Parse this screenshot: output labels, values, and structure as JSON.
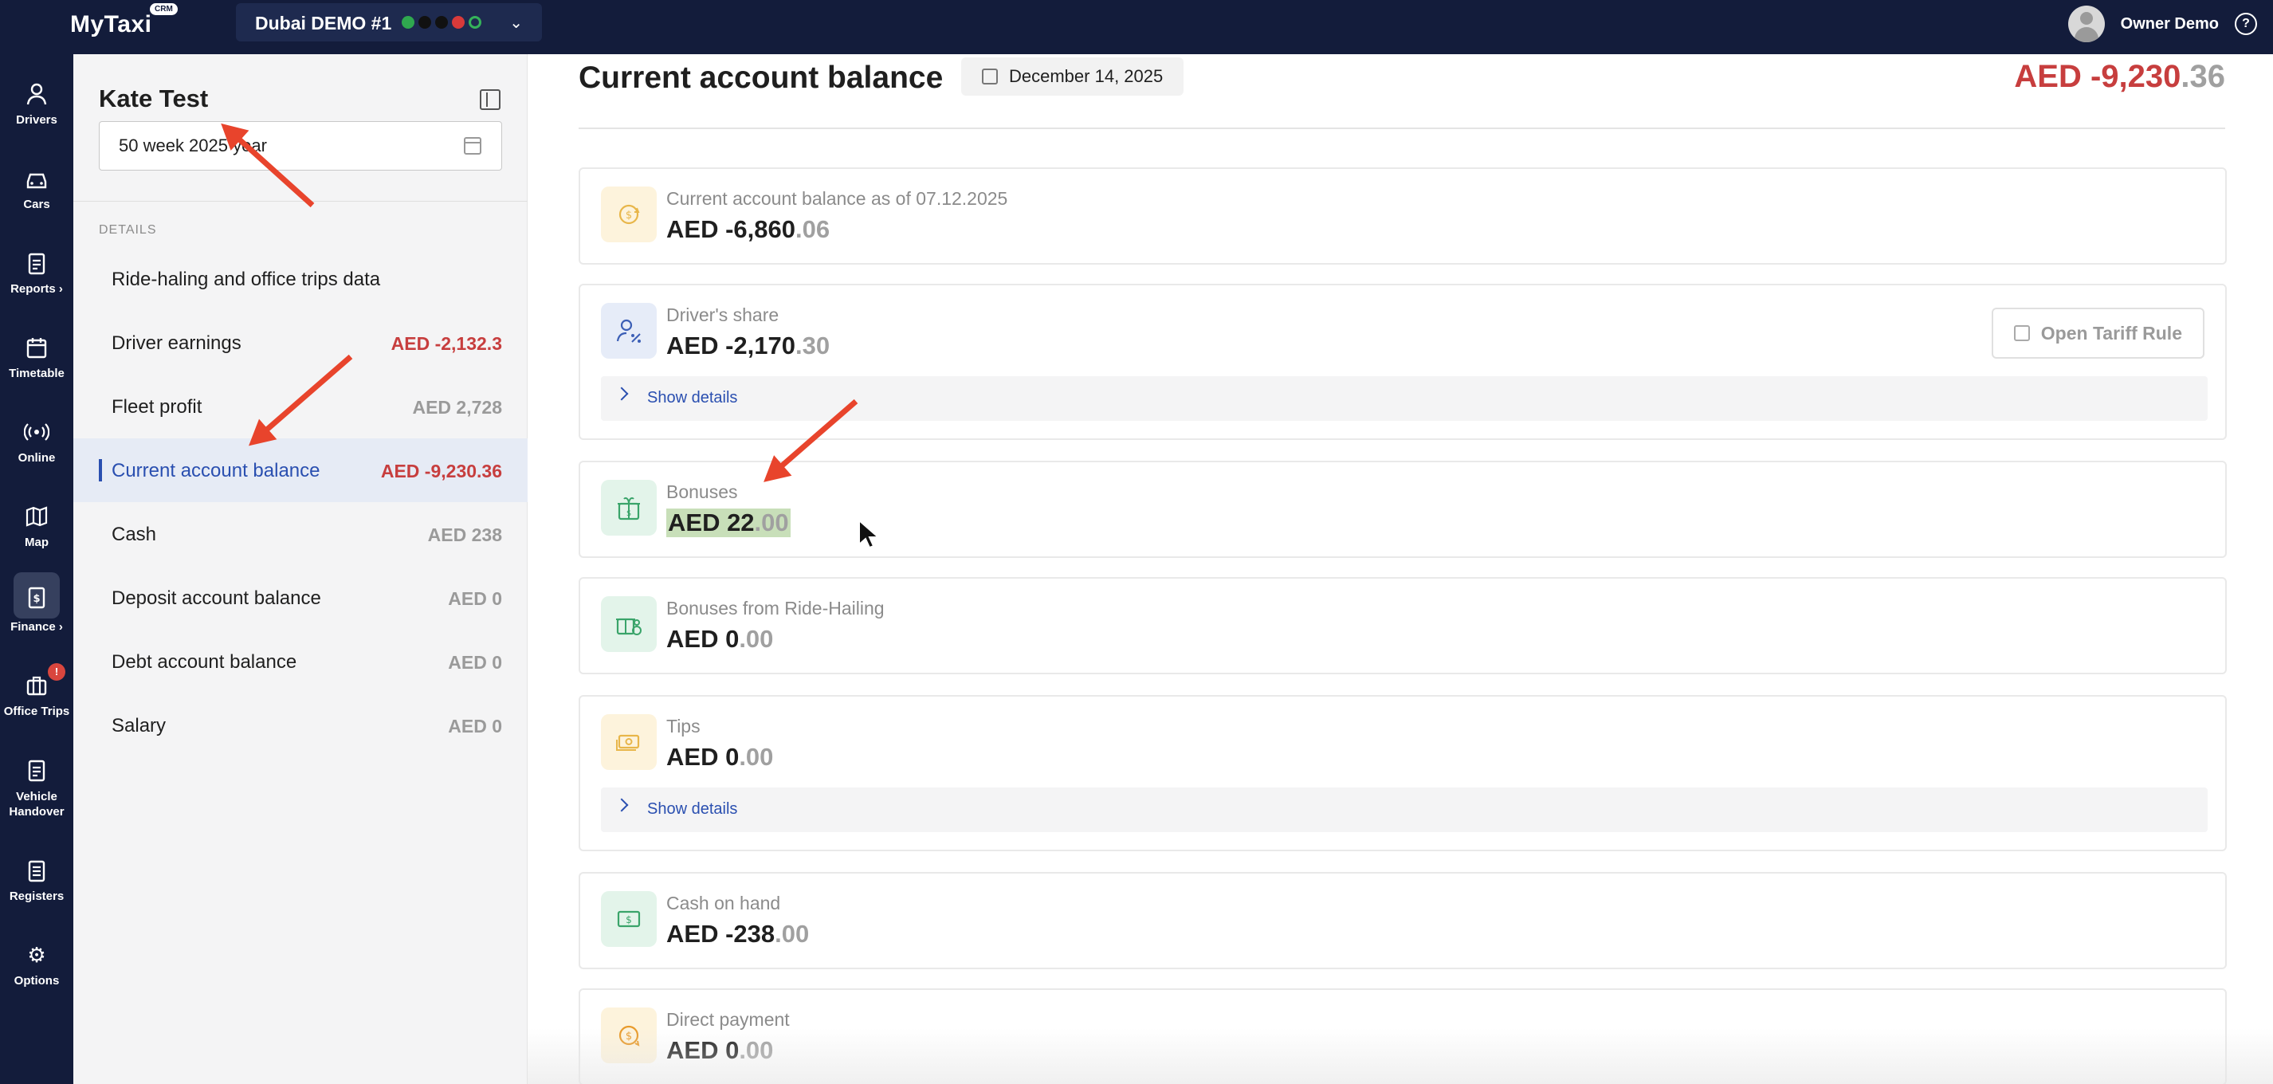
{
  "app": {
    "logo": "MyTaxi",
    "logo_badge": "CRM",
    "company": "Dubai DEMO #1",
    "user_name": "Owner Demo"
  },
  "nav": [
    {
      "label": "Drivers",
      "icon": "person-icon"
    },
    {
      "label": "Cars",
      "icon": "car-icon"
    },
    {
      "label": "Reports ›",
      "icon": "clipboard-icon"
    },
    {
      "label": "Timetable",
      "icon": "calendar-icon"
    },
    {
      "label": "Online",
      "icon": "signal-icon"
    },
    {
      "label": "Map",
      "icon": "map-icon"
    },
    {
      "label": "Finance ›",
      "icon": "finance-icon",
      "active": true
    },
    {
      "label": "Office Trips",
      "icon": "briefcase-icon",
      "badge": "!"
    },
    {
      "label": "Vehicle Handover",
      "icon": "clipboard-icon"
    },
    {
      "label": "Registers",
      "icon": "list-icon"
    },
    {
      "label": "Options",
      "icon": "gear-icon"
    }
  ],
  "panel": {
    "driver_name": "Kate Test",
    "week_value": "50 week 2025 year",
    "details_heading": "DETAILS",
    "rows": [
      {
        "label": "Ride-haling and office trips data",
        "value": ""
      },
      {
        "label": "Driver earnings",
        "value": "AED -2,132.3"
      },
      {
        "label": "Fleet profit",
        "value": "AED 2,728"
      },
      {
        "label": "Current account balance",
        "value": "AED -9,230.36"
      },
      {
        "label": "Cash",
        "value": "AED 238"
      },
      {
        "label": "Deposit account balance",
        "value": "AED 0"
      },
      {
        "label": "Debt account balance",
        "value": "AED 0"
      },
      {
        "label": "Salary",
        "value": "AED 0"
      }
    ]
  },
  "main": {
    "title": "Current account balance",
    "date": "December 14, 2025",
    "total_int": "AED -9,230",
    "total_dec": ".36",
    "show_details": "Show details",
    "tariff_button": "Open Tariff Rule",
    "cards": [
      {
        "label": "Current account balance as of 07.12.2025",
        "int": "AED -6,860",
        "dec": ".06"
      },
      {
        "label": "Driver's share",
        "int": "AED -2,170",
        "dec": ".30"
      },
      {
        "label": "Bonuses",
        "int": "AED 22",
        "dec": ".00"
      },
      {
        "label": "Bonuses from Ride-Hailing",
        "int": "AED 0",
        "dec": ".00"
      },
      {
        "label": "Tips",
        "int": "AED 0",
        "dec": ".00"
      },
      {
        "label": "Cash on hand",
        "int": "AED -238",
        "dec": ".00"
      },
      {
        "label": "Direct payment",
        "int": "AED 0",
        "dec": ".00"
      }
    ]
  },
  "colors": {
    "nav_bg": "#131c3b",
    "accent": "#2a4fb0",
    "negative": "#c73e3e",
    "arrow": "#e8442c",
    "highlight": "#c8dfb9"
  }
}
